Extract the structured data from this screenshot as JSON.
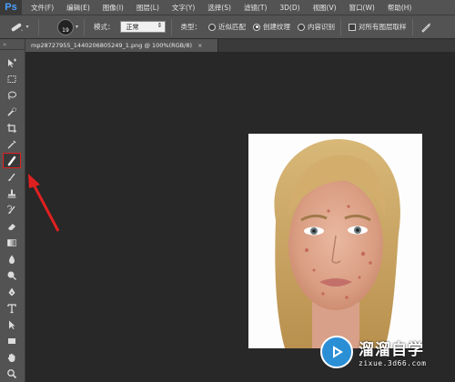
{
  "app": {
    "logo": "Ps"
  },
  "menu": [
    "文件(F)",
    "编辑(E)",
    "图像(I)",
    "图层(L)",
    "文字(Y)",
    "选择(S)",
    "滤镜(T)",
    "3D(D)",
    "视图(V)",
    "窗口(W)",
    "帮助(H)"
  ],
  "options": {
    "brush_size": "19",
    "mode_label": "模式：",
    "mode_value": "正常",
    "type_label": "类型：",
    "type_options": [
      {
        "label": "近似匹配",
        "selected": false
      },
      {
        "label": "创建纹理",
        "selected": true
      },
      {
        "label": "内容识别",
        "selected": false
      }
    ],
    "sample_all_layers": "对所有图层取样",
    "sample_all_layers_checked": false
  },
  "document": {
    "tab_title": "mp28727955_1440206805249_1.png @ 100%(RGB/8)",
    "close_symbol": "×"
  },
  "toolbox": {
    "grip": "»",
    "tools": [
      "move-tool",
      "marquee-tool",
      "lasso-tool",
      "quick-selection-tool",
      "crop-tool",
      "eyedropper-tool",
      "spot-healing-brush-tool",
      "brush-tool",
      "clone-stamp-tool",
      "history-brush-tool",
      "eraser-tool",
      "gradient-tool",
      "blur-tool",
      "dodge-tool",
      "pen-tool",
      "type-tool",
      "path-selection-tool",
      "rectangle-tool",
      "hand-tool",
      "zoom-tool"
    ],
    "active_tool": "spot-healing-brush-tool"
  },
  "annotation": {
    "color": "#e02020"
  },
  "watermark": {
    "title": "溜溜自学",
    "subtitle": "zixue.3d66.com"
  },
  "colors": {
    "menubar": "#535353",
    "canvas": "#282828",
    "accent": "#4a9eff",
    "watermark": "#2b8fd6"
  }
}
